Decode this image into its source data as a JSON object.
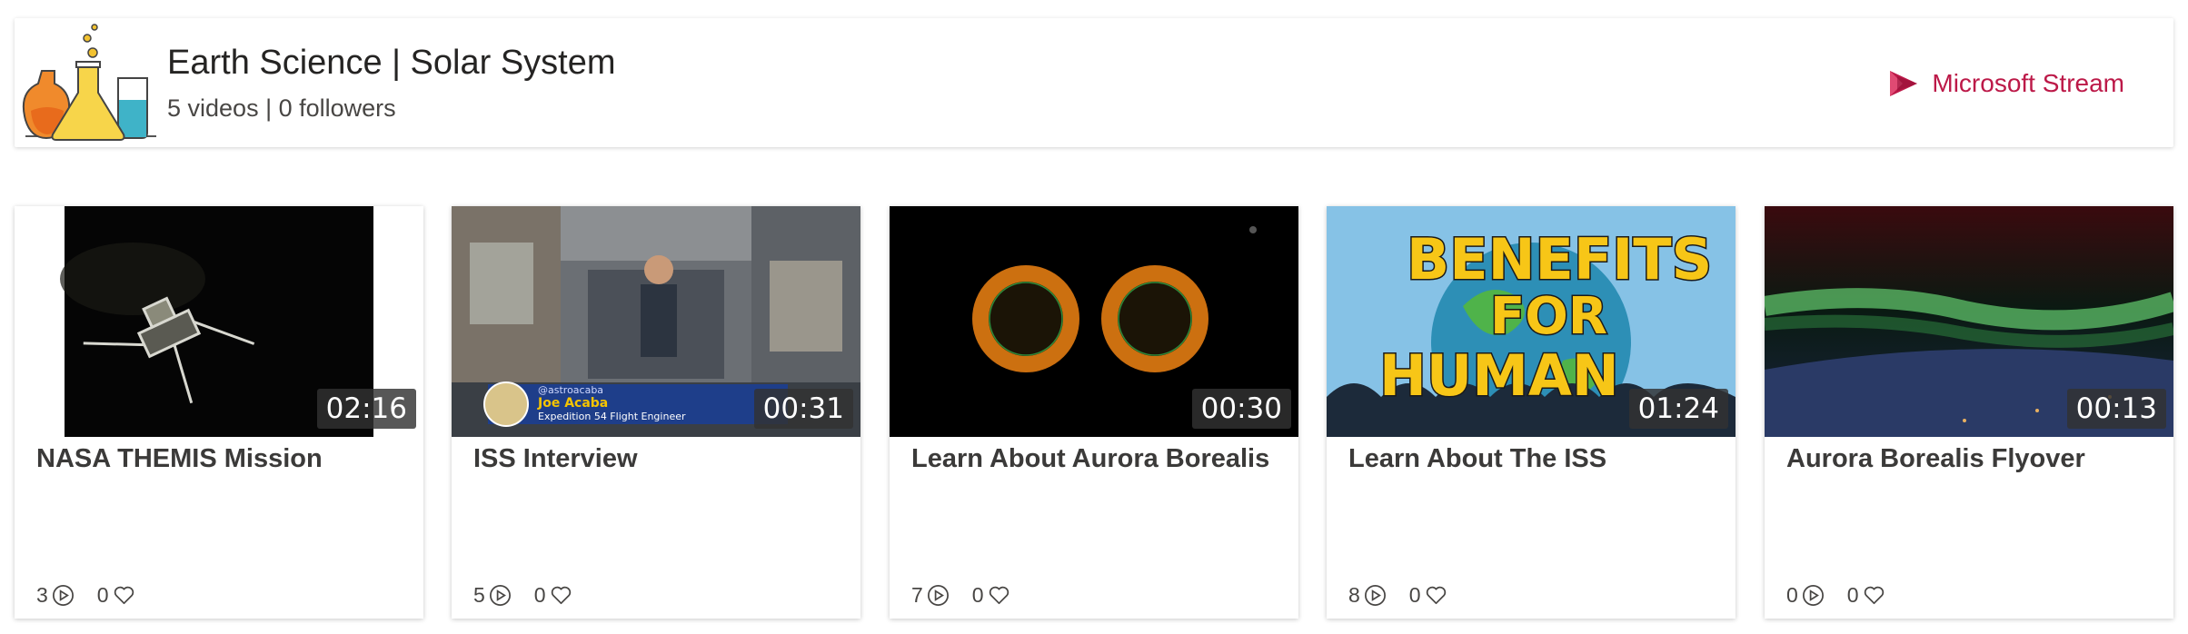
{
  "channel": {
    "title": "Earth Science | Solar System",
    "meta": "5 videos | 0 followers",
    "logo_icon": "science-flasks-icon"
  },
  "brand": {
    "label": "Microsoft Stream",
    "color": "#bc1948",
    "icon": "stream-logo-icon"
  },
  "videos": [
    {
      "title": "NASA THEMIS Mission",
      "duration": "02:16",
      "views": "3",
      "likes": "0"
    },
    {
      "title": "ISS Interview",
      "duration": "00:31",
      "views": "5",
      "likes": "0"
    },
    {
      "title": "Learn About Aurora Borealis",
      "duration": "00:30",
      "views": "7",
      "likes": "0"
    },
    {
      "title": "Learn About The ISS",
      "duration": "01:24",
      "views": "8",
      "likes": "0"
    },
    {
      "title": "Aurora Borealis Flyover",
      "duration": "00:13",
      "views": "0",
      "likes": "0"
    }
  ],
  "thumbnail_text": {
    "iss_handle": "@astroacaba",
    "iss_name": "Joe Acaba",
    "iss_role": "Expedition 54 Flight Engineer",
    "benefits_line1": "BENEFITS",
    "benefits_line2": "FOR",
    "benefits_line3": "HUMAN"
  },
  "icons": {
    "views": "play-circle-icon",
    "likes": "heart-icon"
  }
}
